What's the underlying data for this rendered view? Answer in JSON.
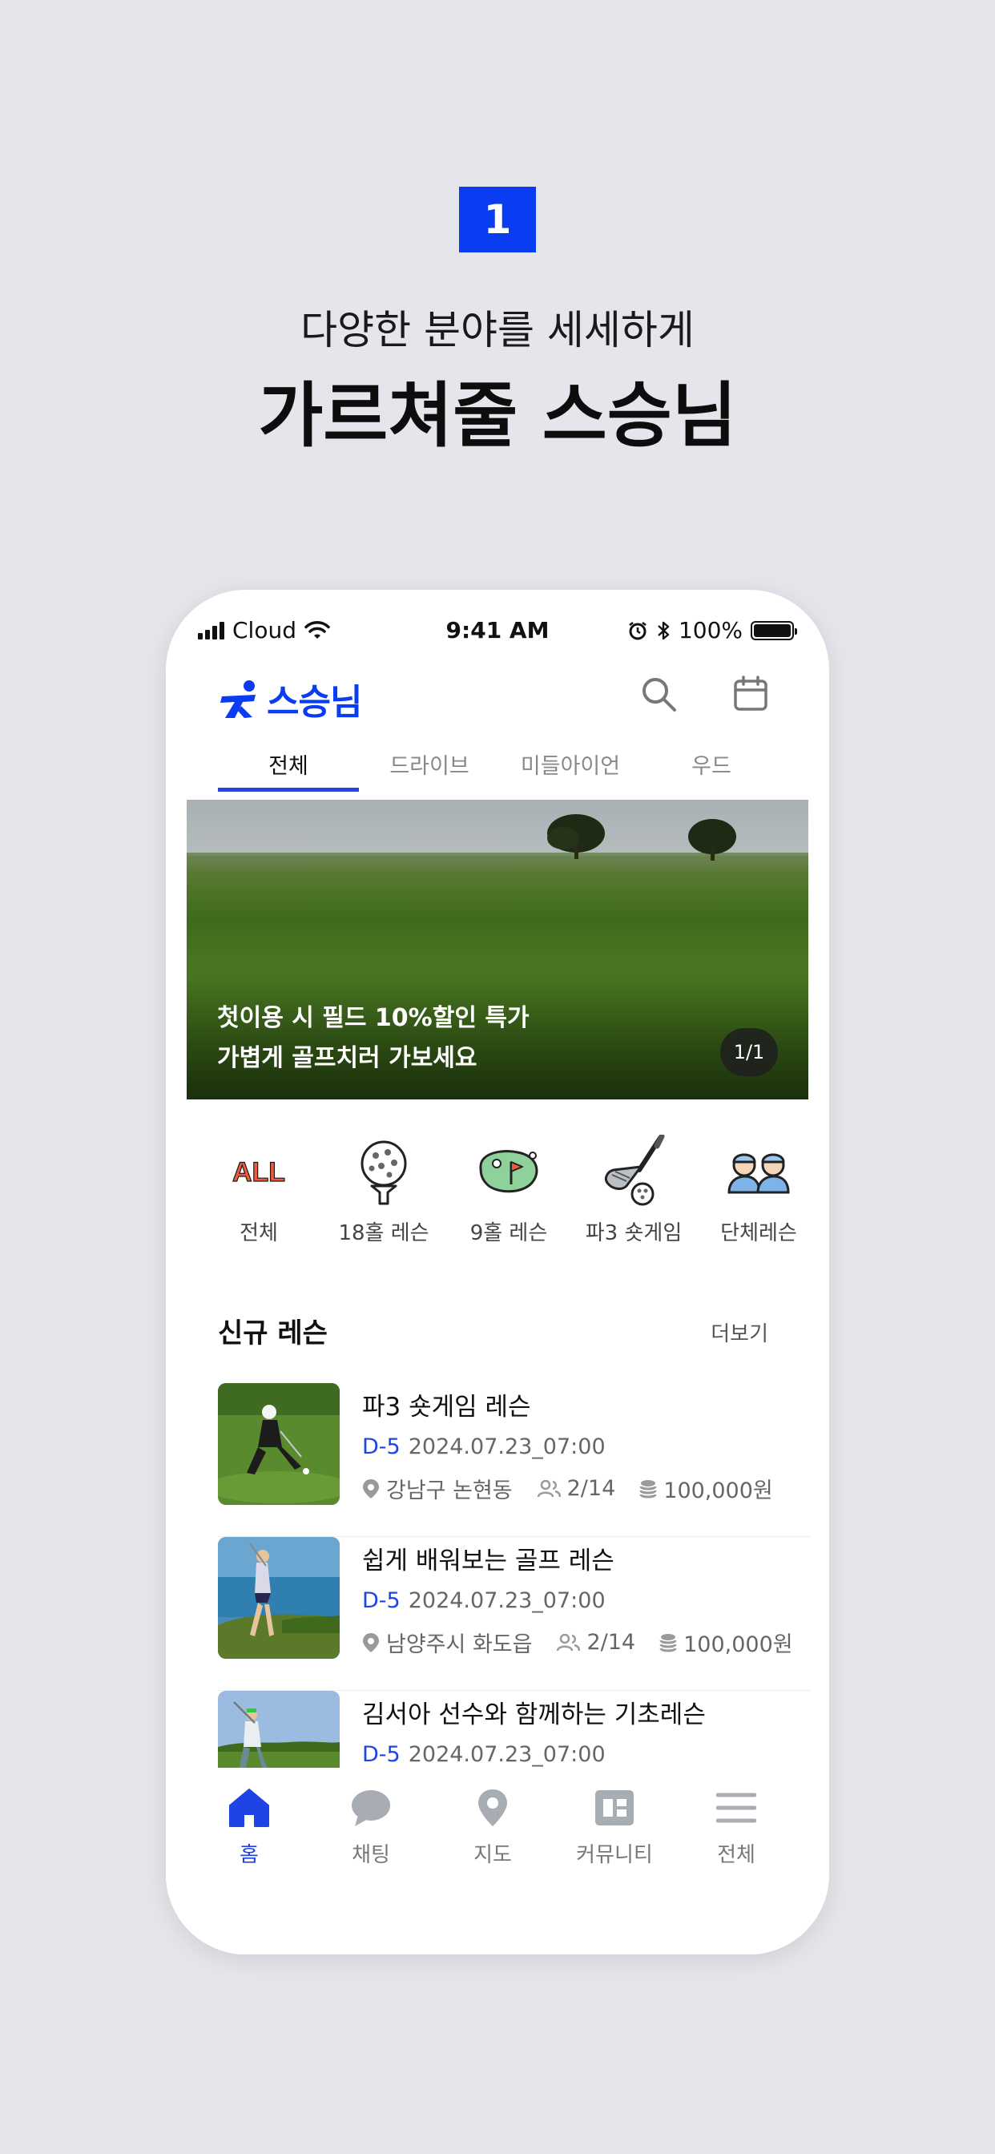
{
  "promo": {
    "step": "1",
    "subtitle": "다양한 분야를 세세하게",
    "title": "가르쳐줄 스승님"
  },
  "status_bar": {
    "carrier": "Cloud",
    "time": "9:41 AM",
    "battery": "100%"
  },
  "header": {
    "logo_text": "스승님",
    "search_icon": "search-icon",
    "calendar_icon": "calendar-icon"
  },
  "tabs": [
    {
      "label": "전체",
      "active": true
    },
    {
      "label": "드라이브",
      "active": false
    },
    {
      "label": "미들아이언",
      "active": false
    },
    {
      "label": "우드",
      "active": false
    }
  ],
  "banner": {
    "line1": "첫이용 시 필드 10%할인 특가",
    "line2": "가볍게 골프치러 가보세요",
    "counter": "1/1"
  },
  "categories": [
    {
      "label": "전체",
      "icon": "all-icon",
      "icon_text": "ALL"
    },
    {
      "label": "18홀 레슨",
      "icon": "golf-ball-tee-icon"
    },
    {
      "label": "9홀 레슨",
      "icon": "golf-green-flag-icon"
    },
    {
      "label": "파3 숏게임",
      "icon": "golf-club-icon"
    },
    {
      "label": "단체레슨",
      "icon": "group-people-icon"
    }
  ],
  "new_lessons": {
    "title": "신규 레슨",
    "more": "더보기",
    "items": [
      {
        "title": "파3 숏게임 레슨",
        "dday": "D-5",
        "datetime": "2024.07.23_07:00",
        "location": "강남구 논현동",
        "people": "2/14",
        "price": "100,000원"
      },
      {
        "title": "쉽게 배워보는 골프 레슨",
        "dday": "D-5",
        "datetime": "2024.07.23_07:00",
        "location": "남양주시 화도읍",
        "people": "2/14",
        "price": "100,000원"
      },
      {
        "title": "김서아 선수와 함께하는 기초레슨",
        "dday": "D-5",
        "datetime": "2024.07.23_07:00",
        "location": "",
        "people": "",
        "price": ""
      }
    ]
  },
  "bottom_nav": [
    {
      "label": "홈",
      "icon": "home-icon",
      "active": true
    },
    {
      "label": "채팅",
      "icon": "chat-icon",
      "active": false
    },
    {
      "label": "지도",
      "icon": "map-pin-icon",
      "active": false
    },
    {
      "label": "커뮤니티",
      "icon": "community-icon",
      "active": false
    },
    {
      "label": "전체",
      "icon": "menu-icon",
      "active": false
    }
  ],
  "colors": {
    "background": "#e4e6eb",
    "accent": "#0a3cf2",
    "dday": "#1f44e6"
  }
}
